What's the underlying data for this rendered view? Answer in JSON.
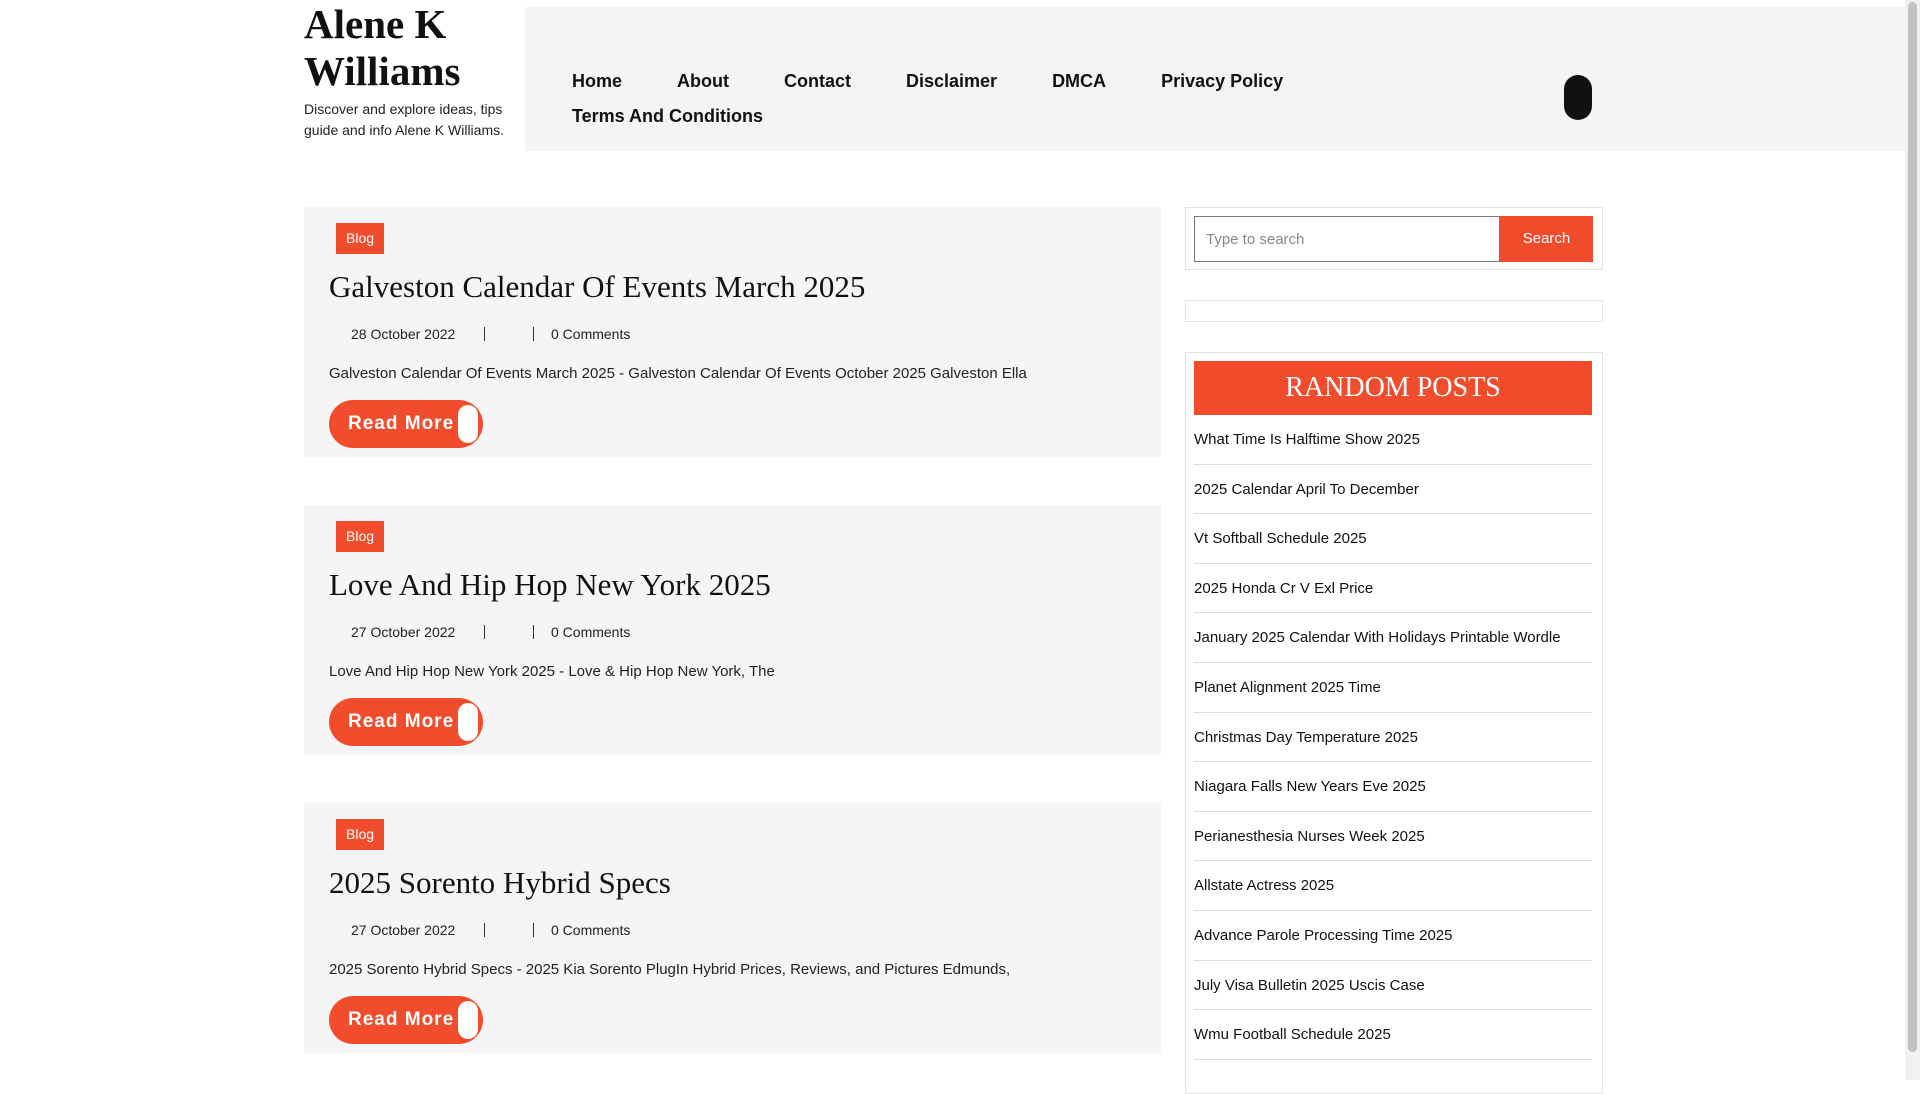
{
  "site": {
    "title_line1": "Alene K",
    "title_line2": "Williams",
    "description": "Discover and explore ideas, tips guide and info Alene K Williams."
  },
  "nav": {
    "items": [
      "Home",
      "About",
      "Contact",
      "Disclaimer",
      "DMCA",
      "Privacy Policy",
      "Terms And Conditions"
    ]
  },
  "posts": [
    {
      "category": "Blog",
      "title": "Galveston Calendar Of Events March 2025",
      "date": "28 October 2022",
      "comments": "0 Comments",
      "excerpt": "Galveston Calendar Of Events March 2025 - Galveston Calendar Of Events October 2025 Galveston Ella",
      "read_more": "Read More"
    },
    {
      "category": "Blog",
      "title": "Love And Hip Hop New York 2025",
      "date": "27 October 2022",
      "comments": "0 Comments",
      "excerpt": "Love And Hip Hop New York 2025 - Love & Hip Hop New York, The",
      "read_more": "Read More"
    },
    {
      "category": "Blog",
      "title": "2025 Sorento Hybrid Specs",
      "date": "27 October 2022",
      "comments": "0 Comments",
      "excerpt": "2025 Sorento Hybrid Specs - 2025 Kia Sorento PlugIn Hybrid Prices, Reviews, and Pictures Edmunds,",
      "read_more": "Read More"
    }
  ],
  "search": {
    "placeholder": "Type to search",
    "button_label": "Search"
  },
  "random_posts": {
    "heading": "RANDOM POSTS",
    "items": [
      "What Time Is Halftime Show 2025",
      "2025 Calendar April To December",
      "Vt Softball Schedule 2025",
      "2025 Honda Cr V Exl Price",
      "January 2025 Calendar With Holidays Printable Wordle",
      "Planet Alignment 2025 Time",
      "Christmas Day Temperature 2025",
      "Niagara Falls New Years Eve 2025",
      "Perianesthesia Nurses Week 2025",
      "Allstate Actress 2025",
      "Advance Parole Processing Time 2025",
      "July Visa Bulletin 2025 Uscis Case",
      "Wmu Football Schedule 2025"
    ]
  },
  "colors": {
    "accent": "#f14d2c",
    "nav_background": "#f4f4f4",
    "card_background": "#f5f5f5"
  }
}
